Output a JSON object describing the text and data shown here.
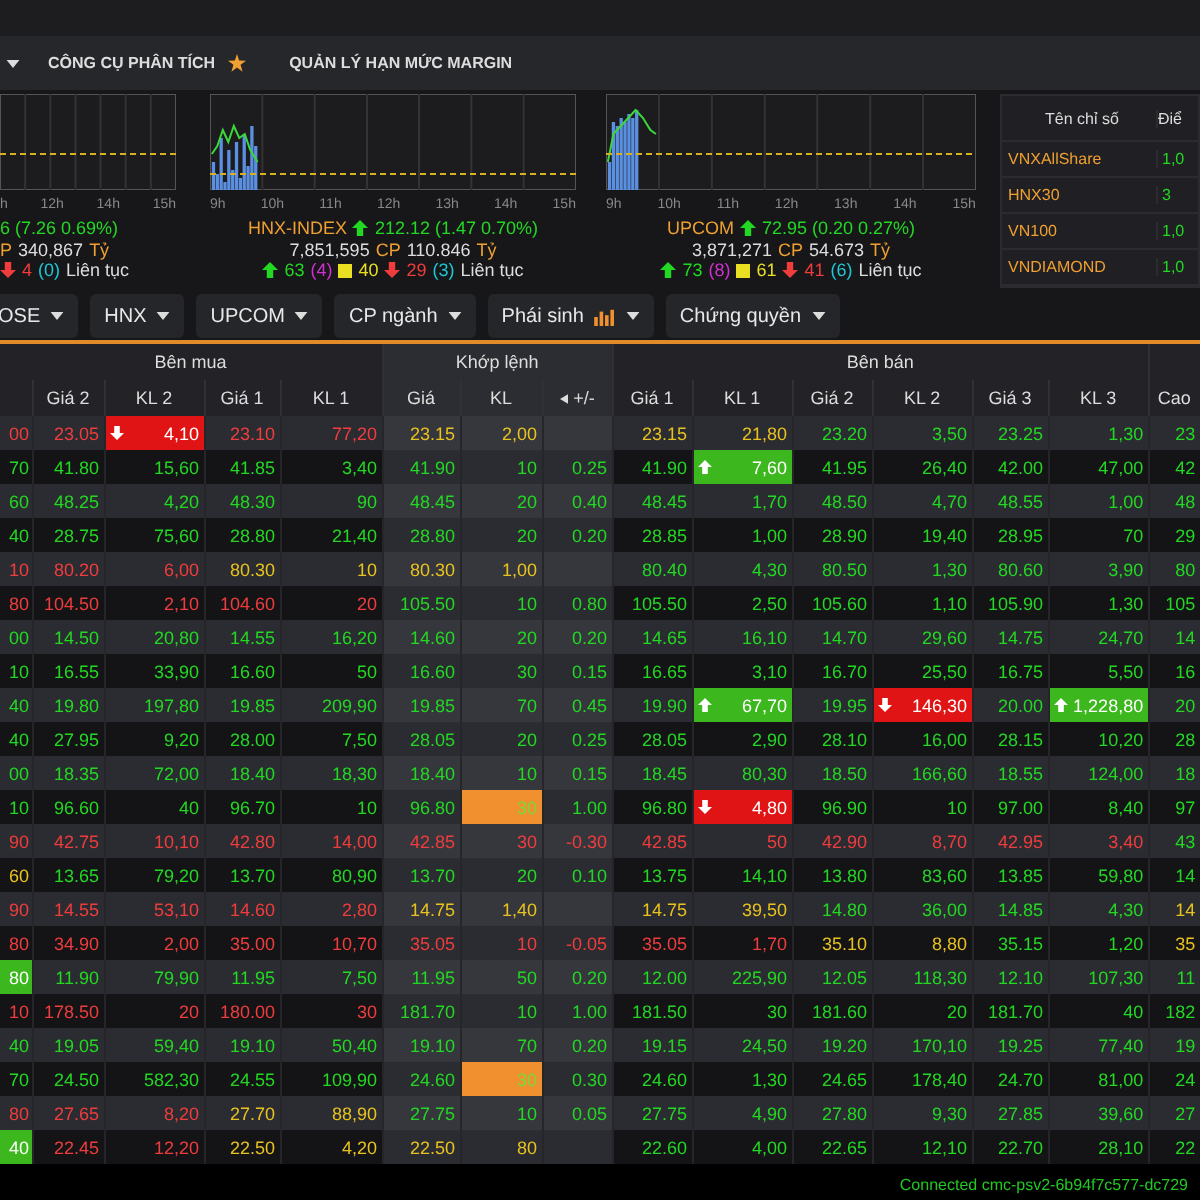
{
  "menu": {
    "items": [
      {
        "label": "CÔNG CỤ PHÂN TÍCH",
        "starred": true
      },
      {
        "label": "QUẢN LÝ HẠN MỨC MARGIN",
        "starred": false
      }
    ]
  },
  "charts": [
    {
      "time_labels": [
        "h",
        "12h",
        "14h",
        "15h"
      ],
      "lines": [
        [
          {
            "kind": "text",
            "text": "6 (7.26 0.69%)",
            "color": "#22d822"
          }
        ],
        [
          {
            "kind": "text",
            "text": "P",
            "color": "#f0a030"
          },
          {
            "kind": "text",
            "text": "340,867",
            "color": "#dddddd"
          },
          {
            "kind": "text",
            "text": "Tỷ",
            "color": "#f0a030"
          }
        ],
        [
          {
            "kind": "down",
            "color": "#f03c3c"
          },
          {
            "kind": "text",
            "text": "4",
            "color": "#f03c3c"
          },
          {
            "kind": "text",
            "text": "(0)",
            "color": "#1fc7d4"
          },
          {
            "kind": "text",
            "text": "Liên tục",
            "color": "#dddddd"
          }
        ]
      ]
    },
    {
      "time_labels": [
        "9h",
        "10h",
        "11h",
        "12h",
        "13h",
        "14h",
        "15h"
      ],
      "lines": [
        [
          {
            "kind": "text",
            "text": "HNX-INDEX",
            "color": "#f0a030"
          },
          {
            "kind": "up",
            "color": "#22d822"
          },
          {
            "kind": "text",
            "text": "212.12 (1.47 0.70%)",
            "color": "#22d822"
          }
        ],
        [
          {
            "kind": "text",
            "text": "7,851,595",
            "color": "#dddddd"
          },
          {
            "kind": "text",
            "text": "CP",
            "color": "#f0a030"
          },
          {
            "kind": "text",
            "text": "110.846",
            "color": "#dddddd"
          },
          {
            "kind": "text",
            "text": "Tỷ",
            "color": "#f0a030"
          }
        ],
        [
          {
            "kind": "up",
            "color": "#22d822"
          },
          {
            "kind": "text",
            "text": "63",
            "color": "#22d822"
          },
          {
            "kind": "text",
            "text": "(4)",
            "color": "#d030d0"
          },
          {
            "kind": "square",
            "color": "#e8e020"
          },
          {
            "kind": "text",
            "text": "40",
            "color": "#e8e020"
          },
          {
            "kind": "down",
            "color": "#f03c3c"
          },
          {
            "kind": "text",
            "text": "29",
            "color": "#f03c3c"
          },
          {
            "kind": "text",
            "text": "(3)",
            "color": "#1fc7d4"
          },
          {
            "kind": "text",
            "text": "Liên tục",
            "color": "#dddddd"
          }
        ]
      ]
    },
    {
      "time_labels": [
        "9h",
        "10h",
        "11h",
        "12h",
        "13h",
        "14h",
        "15h"
      ],
      "lines": [
        [
          {
            "kind": "text",
            "text": "UPCOM",
            "color": "#f0a030"
          },
          {
            "kind": "up",
            "color": "#22d822"
          },
          {
            "kind": "text",
            "text": "72.95 (0.20 0.27%)",
            "color": "#22d822"
          }
        ],
        [
          {
            "kind": "text",
            "text": "3,871,271",
            "color": "#dddddd"
          },
          {
            "kind": "text",
            "text": "CP",
            "color": "#f0a030"
          },
          {
            "kind": "text",
            "text": "54.673",
            "color": "#dddddd"
          },
          {
            "kind": "text",
            "text": "Tỷ",
            "color": "#f0a030"
          }
        ],
        [
          {
            "kind": "up",
            "color": "#22d822"
          },
          {
            "kind": "text",
            "text": "73",
            "color": "#22d822"
          },
          {
            "kind": "text",
            "text": "(8)",
            "color": "#d030d0"
          },
          {
            "kind": "square",
            "color": "#e8e020"
          },
          {
            "kind": "text",
            "text": "61",
            "color": "#e8e020"
          },
          {
            "kind": "down",
            "color": "#f03c3c"
          },
          {
            "kind": "text",
            "text": "41",
            "color": "#f03c3c"
          },
          {
            "kind": "text",
            "text": "(6)",
            "color": "#1fc7d4"
          },
          {
            "kind": "text",
            "text": "Liên tục",
            "color": "#dddddd"
          }
        ]
      ]
    }
  ],
  "index_table": {
    "columns": [
      "Tên chỉ số",
      "Điể"
    ],
    "rows": [
      {
        "name": "VNXAllShare",
        "value": "1,0"
      },
      {
        "name": "HNX30",
        "value": "3"
      },
      {
        "name": "VN100",
        "value": "1,0"
      },
      {
        "name": "VNDIAMOND",
        "value": "1,0"
      }
    ]
  },
  "tabs": [
    {
      "label": "OSE",
      "kind": "plain"
    },
    {
      "label": "HNX",
      "kind": "plain"
    },
    {
      "label": "UPCOM",
      "kind": "plain"
    },
    {
      "label": "CP ngành",
      "kind": "plain"
    },
    {
      "label": "Phái sinh",
      "kind": "chart"
    },
    {
      "label": "Chứng quyền",
      "kind": "plain"
    }
  ],
  "board": {
    "groups": [
      {
        "label": "Bên mua",
        "kind": "buy",
        "columns": [
          {},
          {
            "label": "Giá 2"
          },
          {
            "label": "KL 2"
          },
          {
            "label": "Giá 1"
          },
          {
            "label": "KL 1"
          }
        ]
      },
      {
        "label": "Khớp lệnh",
        "kind": "match",
        "columns": [
          {
            "label": "Giá"
          },
          {
            "label": "KL"
          },
          {
            "label": "+/-",
            "toggle": true
          }
        ]
      },
      {
        "label": "Bên bán",
        "kind": "sell",
        "columns": [
          {
            "label": "Giá 1"
          },
          {
            "label": "KL 1"
          },
          {
            "label": "Giá 2"
          },
          {
            "label": "KL 2"
          },
          {
            "label": "Giá 3"
          },
          {
            "label": "KL 3"
          }
        ]
      },
      {
        "kind": "other",
        "columns": [
          {
            "label": "Cao"
          }
        ]
      }
    ],
    "rows": [
      {
        "cells": [
          {
            "text": "00",
            "color": "#f03c3c"
          },
          {
            "text": "23.05",
            "color": "#f03c3c"
          },
          {
            "text": "4,10",
            "color": "#ffffff",
            "kind": "down",
            "arrow": true
          },
          {
            "text": "23.10",
            "color": "#f03c3c"
          },
          {
            "text": "77,20",
            "color": "#f03c3c"
          },
          {
            "text": "23.15",
            "color": "#e8c21e"
          },
          {
            "text": "2,00",
            "color": "#e8c21e"
          },
          {},
          {
            "text": "23.15",
            "color": "#e8c21e"
          },
          {
            "text": "21,80",
            "color": "#e8c21e"
          },
          {
            "text": "23.20",
            "color": "#22d822"
          },
          {
            "text": "3,50",
            "color": "#22d822"
          },
          {
            "text": "23.25",
            "color": "#22d822"
          },
          {
            "text": "1,30",
            "color": "#22d822"
          },
          {
            "text": "23",
            "color": "#22d822"
          }
        ]
      },
      {
        "cells": [
          {
            "text": "70",
            "color": "#22d822"
          },
          {
            "text": "41.80",
            "color": "#22d822"
          },
          {
            "text": "15,60",
            "color": "#22d822"
          },
          {
            "text": "41.85",
            "color": "#22d822"
          },
          {
            "text": "3,40",
            "color": "#22d822"
          },
          {
            "text": "41.90",
            "color": "#22d822"
          },
          {
            "text": "10",
            "color": "#22d822"
          },
          {
            "text": "0.25",
            "color": "#22d822"
          },
          {
            "text": "41.90",
            "color": "#22d822"
          },
          {
            "text": "7,60",
            "color": "#ffffff",
            "kind": "up",
            "arrow": true
          },
          {
            "text": "41.95",
            "color": "#22d822"
          },
          {
            "text": "26,40",
            "color": "#22d822"
          },
          {
            "text": "42.00",
            "color": "#22d822"
          },
          {
            "text": "47,00",
            "color": "#22d822"
          },
          {
            "text": "42",
            "color": "#22d822"
          }
        ]
      },
      {
        "cells": [
          {
            "text": "60",
            "color": "#22d822"
          },
          {
            "text": "48.25",
            "color": "#22d822"
          },
          {
            "text": "4,20",
            "color": "#22d822"
          },
          {
            "text": "48.30",
            "color": "#22d822"
          },
          {
            "text": "90",
            "color": "#22d822"
          },
          {
            "text": "48.45",
            "color": "#22d822"
          },
          {
            "text": "20",
            "color": "#22d822"
          },
          {
            "text": "0.40",
            "color": "#22d822"
          },
          {
            "text": "48.45",
            "color": "#22d822"
          },
          {
            "text": "1,70",
            "color": "#22d822"
          },
          {
            "text": "48.50",
            "color": "#22d822"
          },
          {
            "text": "4,70",
            "color": "#22d822"
          },
          {
            "text": "48.55",
            "color": "#22d822"
          },
          {
            "text": "1,00",
            "color": "#22d822"
          },
          {
            "text": "48",
            "color": "#22d822"
          }
        ]
      },
      {
        "cells": [
          {
            "text": "40",
            "color": "#22d822"
          },
          {
            "text": "28.75",
            "color": "#22d822"
          },
          {
            "text": "75,60",
            "color": "#22d822"
          },
          {
            "text": "28.80",
            "color": "#22d822"
          },
          {
            "text": "21,40",
            "color": "#22d822"
          },
          {
            "text": "28.80",
            "color": "#22d822"
          },
          {
            "text": "20",
            "color": "#22d822"
          },
          {
            "text": "0.20",
            "color": "#22d822"
          },
          {
            "text": "28.85",
            "color": "#22d822"
          },
          {
            "text": "1,00",
            "color": "#22d822"
          },
          {
            "text": "28.90",
            "color": "#22d822"
          },
          {
            "text": "19,40",
            "color": "#22d822"
          },
          {
            "text": "28.95",
            "color": "#22d822"
          },
          {
            "text": "70",
            "color": "#22d822"
          },
          {
            "text": "29",
            "color": "#22d822"
          }
        ]
      },
      {
        "cells": [
          {
            "text": "10",
            "color": "#f03c3c"
          },
          {
            "text": "80.20",
            "color": "#f03c3c"
          },
          {
            "text": "6,00",
            "color": "#f03c3c"
          },
          {
            "text": "80.30",
            "color": "#e8c21e"
          },
          {
            "text": "10",
            "color": "#e8c21e"
          },
          {
            "text": "80.30",
            "color": "#e8c21e"
          },
          {
            "text": "1,00",
            "color": "#e8c21e"
          },
          {},
          {
            "text": "80.40",
            "color": "#22d822"
          },
          {
            "text": "4,30",
            "color": "#22d822"
          },
          {
            "text": "80.50",
            "color": "#22d822"
          },
          {
            "text": "1,30",
            "color": "#22d822"
          },
          {
            "text": "80.60",
            "color": "#22d822"
          },
          {
            "text": "3,90",
            "color": "#22d822"
          },
          {
            "text": "80",
            "color": "#22d822"
          }
        ]
      },
      {
        "cells": [
          {
            "text": "80",
            "color": "#f03c3c"
          },
          {
            "text": "104.50",
            "color": "#f03c3c"
          },
          {
            "text": "2,10",
            "color": "#f03c3c"
          },
          {
            "text": "104.60",
            "color": "#f03c3c"
          },
          {
            "text": "20",
            "color": "#f03c3c"
          },
          {
            "text": "105.50",
            "color": "#22d822"
          },
          {
            "text": "10",
            "color": "#22d822"
          },
          {
            "text": "0.80",
            "color": "#22d822"
          },
          {
            "text": "105.50",
            "color": "#22d822"
          },
          {
            "text": "2,50",
            "color": "#22d822"
          },
          {
            "text": "105.60",
            "color": "#22d822"
          },
          {
            "text": "1,10",
            "color": "#22d822"
          },
          {
            "text": "105.90",
            "color": "#22d822"
          },
          {
            "text": "1,30",
            "color": "#22d822"
          },
          {
            "text": "105",
            "color": "#22d822"
          }
        ]
      },
      {
        "cells": [
          {
            "text": "00",
            "color": "#22d822"
          },
          {
            "text": "14.50",
            "color": "#22d822"
          },
          {
            "text": "20,80",
            "color": "#22d822"
          },
          {
            "text": "14.55",
            "color": "#22d822"
          },
          {
            "text": "16,20",
            "color": "#22d822"
          },
          {
            "text": "14.60",
            "color": "#22d822"
          },
          {
            "text": "20",
            "color": "#22d822"
          },
          {
            "text": "0.20",
            "color": "#22d822"
          },
          {
            "text": "14.65",
            "color": "#22d822"
          },
          {
            "text": "16,10",
            "color": "#22d822"
          },
          {
            "text": "14.70",
            "color": "#22d822"
          },
          {
            "text": "29,60",
            "color": "#22d822"
          },
          {
            "text": "14.75",
            "color": "#22d822"
          },
          {
            "text": "24,70",
            "color": "#22d822"
          },
          {
            "text": "14",
            "color": "#22d822"
          }
        ]
      },
      {
        "cells": [
          {
            "text": "10",
            "color": "#22d822"
          },
          {
            "text": "16.55",
            "color": "#22d822"
          },
          {
            "text": "33,90",
            "color": "#22d822"
          },
          {
            "text": "16.60",
            "color": "#22d822"
          },
          {
            "text": "50",
            "color": "#22d822"
          },
          {
            "text": "16.60",
            "color": "#22d822"
          },
          {
            "text": "30",
            "color": "#22d822"
          },
          {
            "text": "0.15",
            "color": "#22d822"
          },
          {
            "text": "16.65",
            "color": "#22d822"
          },
          {
            "text": "3,10",
            "color": "#22d822"
          },
          {
            "text": "16.70",
            "color": "#22d822"
          },
          {
            "text": "25,50",
            "color": "#22d822"
          },
          {
            "text": "16.75",
            "color": "#22d822"
          },
          {
            "text": "5,50",
            "color": "#22d822"
          },
          {
            "text": "16",
            "color": "#22d822"
          }
        ]
      },
      {
        "cells": [
          {
            "text": "40",
            "color": "#22d822"
          },
          {
            "text": "19.80",
            "color": "#22d822"
          },
          {
            "text": "197,80",
            "color": "#22d822"
          },
          {
            "text": "19.85",
            "color": "#22d822"
          },
          {
            "text": "209,90",
            "color": "#22d822"
          },
          {
            "text": "19.85",
            "color": "#22d822"
          },
          {
            "text": "70",
            "color": "#22d822"
          },
          {
            "text": "0.45",
            "color": "#22d822"
          },
          {
            "text": "19.90",
            "color": "#22d822"
          },
          {
            "text": "67,70",
            "color": "#ffffff",
            "kind": "up",
            "arrow": true
          },
          {
            "text": "19.95",
            "color": "#22d822"
          },
          {
            "text": "146,30",
            "color": "#ffffff",
            "kind": "down",
            "arrow": true
          },
          {
            "text": "20.00",
            "color": "#22d822"
          },
          {
            "text": "1,228,80",
            "color": "#ffffff",
            "kind": "up",
            "arrow": true
          },
          {
            "text": "20",
            "color": "#22d822"
          }
        ]
      },
      {
        "cells": [
          {
            "text": "40",
            "color": "#22d822"
          },
          {
            "text": "27.95",
            "color": "#22d822"
          },
          {
            "text": "9,20",
            "color": "#22d822"
          },
          {
            "text": "28.00",
            "color": "#22d822"
          },
          {
            "text": "7,50",
            "color": "#22d822"
          },
          {
            "text": "28.05",
            "color": "#22d822"
          },
          {
            "text": "20",
            "color": "#22d822"
          },
          {
            "text": "0.25",
            "color": "#22d822"
          },
          {
            "text": "28.05",
            "color": "#22d822"
          },
          {
            "text": "2,90",
            "color": "#22d822"
          },
          {
            "text": "28.10",
            "color": "#22d822"
          },
          {
            "text": "16,00",
            "color": "#22d822"
          },
          {
            "text": "28.15",
            "color": "#22d822"
          },
          {
            "text": "10,20",
            "color": "#22d822"
          },
          {
            "text": "28",
            "color": "#22d822"
          }
        ]
      },
      {
        "cells": [
          {
            "text": "00",
            "color": "#22d822"
          },
          {
            "text": "18.35",
            "color": "#22d822"
          },
          {
            "text": "72,00",
            "color": "#22d822"
          },
          {
            "text": "18.40",
            "color": "#22d822"
          },
          {
            "text": "18,30",
            "color": "#22d822"
          },
          {
            "text": "18.40",
            "color": "#22d822"
          },
          {
            "text": "10",
            "color": "#22d822"
          },
          {
            "text": "0.15",
            "color": "#22d822"
          },
          {
            "text": "18.45",
            "color": "#22d822"
          },
          {
            "text": "80,30",
            "color": "#22d822"
          },
          {
            "text": "18.50",
            "color": "#22d822"
          },
          {
            "text": "166,60",
            "color": "#22d822"
          },
          {
            "text": "18.55",
            "color": "#22d822"
          },
          {
            "text": "124,00",
            "color": "#22d822"
          },
          {
            "text": "18",
            "color": "#22d822"
          }
        ]
      },
      {
        "cells": [
          {
            "text": "10",
            "color": "#22d822"
          },
          {
            "text": "96.60",
            "color": "#22d822"
          },
          {
            "text": "40",
            "color": "#22d822"
          },
          {
            "text": "96.70",
            "color": "#22d822"
          },
          {
            "text": "10",
            "color": "#22d822"
          },
          {
            "text": "96.80",
            "color": "#22d822"
          },
          {
            "text": "30",
            "color": "#7ad83a",
            "kind": "match"
          },
          {
            "text": "1.00",
            "color": "#22d822"
          },
          {
            "text": "96.80",
            "color": "#22d822"
          },
          {
            "text": "4,80",
            "color": "#ffffff",
            "kind": "down",
            "arrow": true
          },
          {
            "text": "96.90",
            "color": "#22d822"
          },
          {
            "text": "10",
            "color": "#22d822"
          },
          {
            "text": "97.00",
            "color": "#22d822"
          },
          {
            "text": "8,40",
            "color": "#22d822"
          },
          {
            "text": "97",
            "color": "#22d822"
          }
        ]
      },
      {
        "cells": [
          {
            "text": "90",
            "color": "#f03c3c"
          },
          {
            "text": "42.75",
            "color": "#f03c3c"
          },
          {
            "text": "10,10",
            "color": "#f03c3c"
          },
          {
            "text": "42.80",
            "color": "#f03c3c"
          },
          {
            "text": "14,00",
            "color": "#f03c3c"
          },
          {
            "text": "42.85",
            "color": "#f03c3c"
          },
          {
            "text": "30",
            "color": "#f03c3c"
          },
          {
            "text": "-0.30",
            "color": "#f03c3c"
          },
          {
            "text": "42.85",
            "color": "#f03c3c"
          },
          {
            "text": "50",
            "color": "#f03c3c"
          },
          {
            "text": "42.90",
            "color": "#f03c3c"
          },
          {
            "text": "8,70",
            "color": "#f03c3c"
          },
          {
            "text": "42.95",
            "color": "#f03c3c"
          },
          {
            "text": "3,40",
            "color": "#f03c3c"
          },
          {
            "text": "43",
            "color": "#22d822"
          }
        ]
      },
      {
        "cells": [
          {
            "text": "60",
            "color": "#e8c21e"
          },
          {
            "text": "13.65",
            "color": "#22d822"
          },
          {
            "text": "79,20",
            "color": "#22d822"
          },
          {
            "text": "13.70",
            "color": "#22d822"
          },
          {
            "text": "80,90",
            "color": "#22d822"
          },
          {
            "text": "13.70",
            "color": "#22d822"
          },
          {
            "text": "20",
            "color": "#22d822"
          },
          {
            "text": "0.10",
            "color": "#22d822"
          },
          {
            "text": "13.75",
            "color": "#22d822"
          },
          {
            "text": "14,10",
            "color": "#22d822"
          },
          {
            "text": "13.80",
            "color": "#22d822"
          },
          {
            "text": "83,60",
            "color": "#22d822"
          },
          {
            "text": "13.85",
            "color": "#22d822"
          },
          {
            "text": "59,80",
            "color": "#22d822"
          },
          {
            "text": "14",
            "color": "#22d822"
          }
        ]
      },
      {
        "cells": [
          {
            "text": "90",
            "color": "#f03c3c"
          },
          {
            "text": "14.55",
            "color": "#f03c3c"
          },
          {
            "text": "53,10",
            "color": "#f03c3c"
          },
          {
            "text": "14.60",
            "color": "#f03c3c"
          },
          {
            "text": "2,80",
            "color": "#f03c3c"
          },
          {
            "text": "14.75",
            "color": "#e8c21e"
          },
          {
            "text": "1,40",
            "color": "#e8c21e"
          },
          {},
          {
            "text": "14.75",
            "color": "#e8c21e"
          },
          {
            "text": "39,50",
            "color": "#e8c21e"
          },
          {
            "text": "14.80",
            "color": "#22d822"
          },
          {
            "text": "36,00",
            "color": "#22d822"
          },
          {
            "text": "14.85",
            "color": "#22d822"
          },
          {
            "text": "4,30",
            "color": "#22d822"
          },
          {
            "text": "14",
            "color": "#e8c21e"
          }
        ]
      },
      {
        "cells": [
          {
            "text": "80",
            "color": "#f03c3c"
          },
          {
            "text": "34.90",
            "color": "#f03c3c"
          },
          {
            "text": "2,00",
            "color": "#f03c3c"
          },
          {
            "text": "35.00",
            "color": "#f03c3c"
          },
          {
            "text": "10,70",
            "color": "#f03c3c"
          },
          {
            "text": "35.05",
            "color": "#f03c3c"
          },
          {
            "text": "10",
            "color": "#f03c3c"
          },
          {
            "text": "-0.05",
            "color": "#f03c3c"
          },
          {
            "text": "35.05",
            "color": "#f03c3c"
          },
          {
            "text": "1,70",
            "color": "#f03c3c"
          },
          {
            "text": "35.10",
            "color": "#e8c21e"
          },
          {
            "text": "8,80",
            "color": "#e8c21e"
          },
          {
            "text": "35.15",
            "color": "#22d822"
          },
          {
            "text": "1,20",
            "color": "#22d822"
          },
          {
            "text": "35",
            "color": "#e8c21e"
          }
        ]
      },
      {
        "cells": [
          {
            "text": "80",
            "color": "#ffffff",
            "kind": "up"
          },
          {
            "text": "11.90",
            "color": "#22d822"
          },
          {
            "text": "79,90",
            "color": "#22d822"
          },
          {
            "text": "11.95",
            "color": "#22d822"
          },
          {
            "text": "7,50",
            "color": "#22d822"
          },
          {
            "text": "11.95",
            "color": "#22d822"
          },
          {
            "text": "50",
            "color": "#22d822"
          },
          {
            "text": "0.20",
            "color": "#22d822"
          },
          {
            "text": "12.00",
            "color": "#22d822"
          },
          {
            "text": "225,90",
            "color": "#22d822"
          },
          {
            "text": "12.05",
            "color": "#22d822"
          },
          {
            "text": "118,30",
            "color": "#22d822"
          },
          {
            "text": "12.10",
            "color": "#22d822"
          },
          {
            "text": "107,30",
            "color": "#22d822"
          },
          {
            "text": "11",
            "color": "#22d822"
          }
        ]
      },
      {
        "cells": [
          {
            "text": "10",
            "color": "#f03c3c"
          },
          {
            "text": "178.50",
            "color": "#f03c3c"
          },
          {
            "text": "20",
            "color": "#f03c3c"
          },
          {
            "text": "180.00",
            "color": "#f03c3c"
          },
          {
            "text": "30",
            "color": "#f03c3c"
          },
          {
            "text": "181.70",
            "color": "#22d822"
          },
          {
            "text": "10",
            "color": "#22d822"
          },
          {
            "text": "1.00",
            "color": "#22d822"
          },
          {
            "text": "181.50",
            "color": "#22d822"
          },
          {
            "text": "30",
            "color": "#22d822"
          },
          {
            "text": "181.60",
            "color": "#22d822"
          },
          {
            "text": "20",
            "color": "#22d822"
          },
          {
            "text": "181.70",
            "color": "#22d822"
          },
          {
            "text": "40",
            "color": "#22d822"
          },
          {
            "text": "182",
            "color": "#22d822"
          }
        ]
      },
      {
        "cells": [
          {
            "text": "40",
            "color": "#22d822"
          },
          {
            "text": "19.05",
            "color": "#22d822"
          },
          {
            "text": "59,40",
            "color": "#22d822"
          },
          {
            "text": "19.10",
            "color": "#22d822"
          },
          {
            "text": "50,40",
            "color": "#22d822"
          },
          {
            "text": "19.10",
            "color": "#22d822"
          },
          {
            "text": "70",
            "color": "#22d822"
          },
          {
            "text": "0.20",
            "color": "#22d822"
          },
          {
            "text": "19.15",
            "color": "#22d822"
          },
          {
            "text": "24,50",
            "color": "#22d822"
          },
          {
            "text": "19.20",
            "color": "#22d822"
          },
          {
            "text": "170,10",
            "color": "#22d822"
          },
          {
            "text": "19.25",
            "color": "#22d822"
          },
          {
            "text": "77,40",
            "color": "#22d822"
          },
          {
            "text": "19",
            "color": "#22d822"
          }
        ]
      },
      {
        "cells": [
          {
            "text": "70",
            "color": "#22d822"
          },
          {
            "text": "24.50",
            "color": "#22d822"
          },
          {
            "text": "582,30",
            "color": "#22d822"
          },
          {
            "text": "24.55",
            "color": "#22d822"
          },
          {
            "text": "109,90",
            "color": "#22d822"
          },
          {
            "text": "24.60",
            "color": "#22d822"
          },
          {
            "text": "30",
            "color": "#7ad83a",
            "kind": "match"
          },
          {
            "text": "0.30",
            "color": "#22d822"
          },
          {
            "text": "24.60",
            "color": "#22d822"
          },
          {
            "text": "1,30",
            "color": "#22d822"
          },
          {
            "text": "24.65",
            "color": "#22d822"
          },
          {
            "text": "178,40",
            "color": "#22d822"
          },
          {
            "text": "24.70",
            "color": "#22d822"
          },
          {
            "text": "81,00",
            "color": "#22d822"
          },
          {
            "text": "24",
            "color": "#22d822"
          }
        ]
      },
      {
        "cells": [
          {
            "text": "80",
            "color": "#f03c3c"
          },
          {
            "text": "27.65",
            "color": "#f03c3c"
          },
          {
            "text": "8,20",
            "color": "#f03c3c"
          },
          {
            "text": "27.70",
            "color": "#e8c21e"
          },
          {
            "text": "88,90",
            "color": "#e8c21e"
          },
          {
            "text": "27.75",
            "color": "#22d822"
          },
          {
            "text": "10",
            "color": "#22d822"
          },
          {
            "text": "0.05",
            "color": "#22d822"
          },
          {
            "text": "27.75",
            "color": "#22d822"
          },
          {
            "text": "4,90",
            "color": "#22d822"
          },
          {
            "text": "27.80",
            "color": "#22d822"
          },
          {
            "text": "9,30",
            "color": "#22d822"
          },
          {
            "text": "27.85",
            "color": "#22d822"
          },
          {
            "text": "39,60",
            "color": "#22d822"
          },
          {
            "text": "27",
            "color": "#22d822"
          }
        ]
      },
      {
        "cells": [
          {
            "text": "40",
            "color": "#ffffff",
            "kind": "up"
          },
          {
            "text": "22.45",
            "color": "#f03c3c"
          },
          {
            "text": "12,20",
            "color": "#f03c3c"
          },
          {
            "text": "22.50",
            "color": "#e8c21e"
          },
          {
            "text": "4,20",
            "color": "#e8c21e"
          },
          {
            "text": "22.50",
            "color": "#e8c21e"
          },
          {
            "text": "80",
            "color": "#e8c21e"
          },
          {},
          {
            "text": "22.60",
            "color": "#22d822"
          },
          {
            "text": "4,00",
            "color": "#22d822"
          },
          {
            "text": "22.65",
            "color": "#22d822"
          },
          {
            "text": "12,10",
            "color": "#22d822"
          },
          {
            "text": "22.70",
            "color": "#22d822"
          },
          {
            "text": "28,10",
            "color": "#22d822"
          },
          {
            "text": "22",
            "color": "#22d822"
          }
        ]
      }
    ]
  },
  "status_bar": {
    "text": "Connected cmc-psv2-6b94f7c577-dc729"
  }
}
